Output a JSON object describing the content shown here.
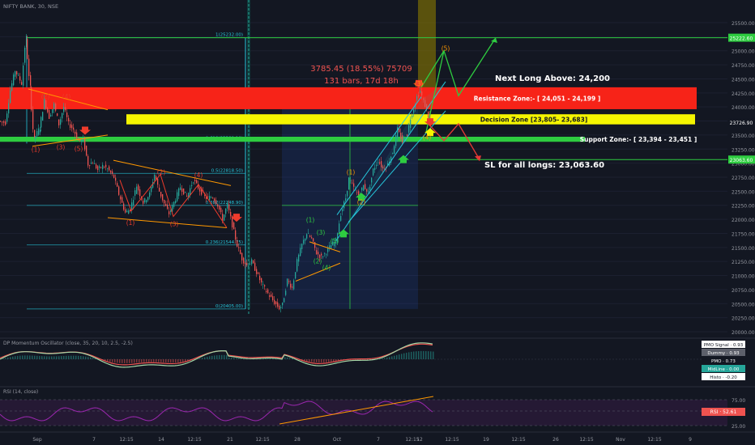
{
  "header": {
    "symbol": "NIFTY BANK, 30, NSE"
  },
  "colors": {
    "background": "#131722",
    "axis_text": "#9598a1",
    "candle_up": "#26a69a",
    "candle_down": "#ef5350",
    "resistance": "#f72318",
    "decision": "#f5f500",
    "support": "#2ecc40",
    "fib": "#26c6da",
    "wave_red": "#ef3b2c",
    "wave_green": "#2ecc40",
    "wave_orange": "#ff9800",
    "projection_green": "#2ecc40",
    "projection_red": "#e53935",
    "osc_panel": "#131722",
    "rsi_band": "#2a1a3a",
    "rsi_line": "#9c27b0"
  },
  "chart_data": {
    "type": "candlestick",
    "title": "NIFTY BANK, 30, NSE",
    "ylim": [
      20000,
      25750
    ],
    "y_ticks": [
      20000,
      20250,
      20500,
      20750,
      21000,
      21250,
      21500,
      21750,
      22000,
      22250,
      22500,
      22750,
      23000,
      23250,
      23500,
      23750,
      24000,
      24250,
      24500,
      24750,
      25000,
      25250,
      25500
    ],
    "x_tick_labels": [
      "Sep",
      "7",
      "12:15",
      "14",
      "12:15",
      "21",
      "12:15",
      "28",
      "Oct",
      "7",
      "12:15",
      "12",
      "12:15",
      "19",
      "12:15",
      "26",
      "12:15",
      "Nov",
      "12:15",
      "9"
    ],
    "price_path": [
      [
        0,
        23750
      ],
      [
        8,
        23720
      ],
      [
        14,
        24300
      ],
      [
        20,
        24650
      ],
      [
        28,
        24420
      ],
      [
        33,
        25232
      ],
      [
        38,
        24350
      ],
      [
        43,
        23430
      ],
      [
        50,
        23620
      ],
      [
        56,
        24120
      ],
      [
        62,
        23820
      ],
      [
        68,
        24040
      ],
      [
        74,
        23690
      ],
      [
        80,
        24000
      ],
      [
        86,
        23700
      ],
      [
        92,
        23600
      ],
      [
        98,
        23400
      ],
      [
        104,
        23420
      ],
      [
        110,
        22980
      ],
      [
        116,
        23020
      ],
      [
        122,
        22880
      ],
      [
        128,
        22950
      ],
      [
        134,
        22900
      ],
      [
        142,
        22750
      ],
      [
        148,
        22450
      ],
      [
        156,
        22120
      ],
      [
        162,
        22180
      ],
      [
        170,
        22600
      ],
      [
        178,
        22300
      ],
      [
        186,
        22450
      ],
      [
        192,
        22800
      ],
      [
        198,
        22500
      ],
      [
        204,
        22280
      ],
      [
        210,
        22100
      ],
      [
        216,
        22300
      ],
      [
        224,
        22580
      ],
      [
        232,
        22400
      ],
      [
        240,
        22700
      ],
      [
        248,
        22520
      ],
      [
        256,
        22380
      ],
      [
        264,
        22400
      ],
      [
        270,
        22260
      ],
      [
        276,
        22000
      ],
      [
        282,
        22260
      ],
      [
        288,
        21900
      ],
      [
        294,
        21540
      ],
      [
        300,
        21300
      ],
      [
        306,
        21180
      ],
      [
        312,
        21250
      ],
      [
        318,
        21060
      ],
      [
        324,
        20860
      ],
      [
        330,
        20720
      ],
      [
        336,
        20600
      ],
      [
        340,
        20520
      ],
      [
        346,
        20420
      ],
      [
        350,
        20480
      ],
      [
        356,
        20920
      ],
      [
        362,
        20780
      ],
      [
        368,
        21250
      ],
      [
        374,
        21550
      ],
      [
        380,
        21750
      ],
      [
        386,
        21650
      ],
      [
        392,
        21400
      ],
      [
        398,
        21330
      ],
      [
        404,
        21420
      ],
      [
        410,
        21540
      ],
      [
        416,
        21620
      ],
      [
        422,
        22100
      ],
      [
        428,
        22380
      ],
      [
        432,
        22720
      ],
      [
        438,
        22560
      ],
      [
        444,
        22420
      ],
      [
        450,
        22600
      ],
      [
        456,
        22480
      ],
      [
        462,
        22880
      ],
      [
        468,
        23050
      ],
      [
        474,
        22900
      ],
      [
        480,
        22980
      ],
      [
        486,
        23200
      ],
      [
        492,
        23600
      ],
      [
        498,
        23380
      ],
      [
        504,
        23520
      ],
      [
        508,
        23800
      ],
      [
        512,
        23980
      ],
      [
        516,
        24180
      ],
      [
        520,
        24280
      ],
      [
        524,
        24100
      ],
      [
        528,
        23950
      ],
      [
        532,
        23726
      ]
    ],
    "last_price": "23726.90",
    "zones": {
      "resistance": {
        "label": "Resistance Zone:- [ 24,051 - 24,199 ]",
        "low": 24051,
        "high": 24199
      },
      "decision": {
        "label": "Decision Zone      [23,805- 23,683]",
        "low": 23683,
        "high": 23805
      },
      "support": {
        "label": "Support Zone:- [ 23,394 - 23,451 ]",
        "low": 23394,
        "high": 23451
      }
    },
    "levels": {
      "top_line": {
        "value": 25232,
        "tag": "25222.60"
      },
      "sl_line": {
        "value": 23063.6,
        "tag": "23063.60"
      }
    },
    "fib_levels": [
      {
        "label": "1(25232.00)",
        "value": 25232
      },
      {
        "label": "0.786(24199.00)",
        "value": 24199
      },
      {
        "label": "0.618(23389.10)",
        "value": 23389
      },
      {
        "label": "0.5(22818.50)",
        "value": 22818
      },
      {
        "label": "0.382(22248.90)",
        "value": 22248
      },
      {
        "label": "0.236(21544.75)",
        "value": 21544
      },
      {
        "label": "0(20405.00)",
        "value": 20405
      }
    ],
    "measure": {
      "line1": "3785.45 (18.55%) 75709",
      "line2": "131 bars, 17d 18h"
    },
    "annotations": {
      "next_long": "Next Long Above: 24,200",
      "sl_note": "SL for all longs: 23,063.60"
    },
    "wave_labels": [
      {
        "text": "(2)",
        "color": "red",
        "x": 56,
        "y": 24150
      },
      {
        "text": "(4)",
        "color": "red",
        "x": 82,
        "y": 24150
      },
      {
        "text": "(1)",
        "color": "red",
        "x": 44,
        "y": 23200
      },
      {
        "text": "(3)",
        "color": "red",
        "x": 75,
        "y": 23250
      },
      {
        "text": "(5)",
        "color": "red",
        "x": 97,
        "y": 23220
      },
      {
        "text": "(2)",
        "color": "red",
        "x": 199,
        "y": 22800
      },
      {
        "text": "(4)",
        "color": "red",
        "x": 245,
        "y": 22750
      },
      {
        "text": "(1)",
        "color": "red",
        "x": 161,
        "y": 21900
      },
      {
        "text": "(3)",
        "color": "red",
        "x": 215,
        "y": 21880
      },
      {
        "text": "(1)",
        "color": "green",
        "x": 383,
        "y": 21950
      },
      {
        "text": "(3)",
        "color": "green",
        "x": 396,
        "y": 21730
      },
      {
        "text": "(5)",
        "color": "green",
        "x": 413,
        "y": 21580
      },
      {
        "text": "(2)",
        "color": "green",
        "x": 392,
        "y": 21220
      },
      {
        "text": "(4)",
        "color": "green",
        "x": 403,
        "y": 21100
      },
      {
        "text": "(1)",
        "color": "orange",
        "x": 433,
        "y": 22800
      },
      {
        "text": "(2)",
        "color": "orange",
        "x": 446,
        "y": 22270
      },
      {
        "text": "(3)",
        "color": "orange",
        "x": 517,
        "y": 24380
      },
      {
        "text": "(4)",
        "color": "orange",
        "x": 527,
        "y": 23420
      },
      {
        "text": "(5)",
        "color": "orange",
        "x": 550,
        "y": 25000
      }
    ],
    "oscillator": {
      "title": "DP Momentum Oscillator (close, 35, 20, 10, 2.5, -2.5)",
      "tags": [
        {
          "label": "PMO Signal",
          "value": "0.93",
          "bg": "#ffffff",
          "fg": "#131722"
        },
        {
          "label": "Dummy",
          "value": "0.93",
          "bg": "#5d606b",
          "fg": "#ffffff"
        },
        {
          "label": "PMO",
          "value": "0.73",
          "bg": "#131722",
          "fg": "#ffffff"
        },
        {
          "label": "MidLine",
          "value": "0.00",
          "bg": "#26a69a",
          "fg": "#ffffff"
        },
        {
          "label": "Histo",
          "value": "-0.20",
          "bg": "#ffffff",
          "fg": "#131722"
        }
      ]
    },
    "rsi": {
      "title": "RSI (14, close)",
      "value_tag": "RSI · 52.61",
      "ticks": [
        "75.00",
        "50.00",
        "25.00"
      ]
    }
  }
}
